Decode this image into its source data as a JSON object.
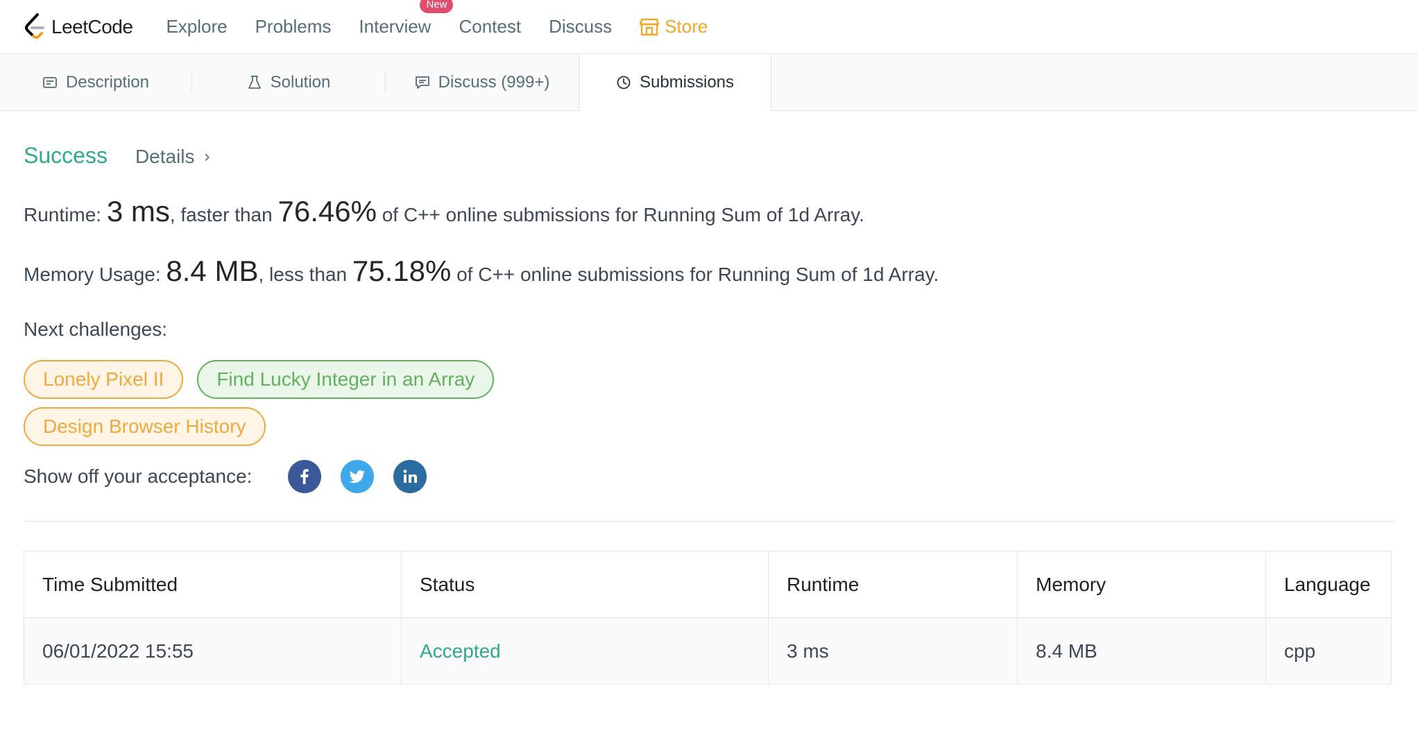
{
  "nav": {
    "logo_text": "LeetCode",
    "items": [
      "Explore",
      "Problems",
      "Interview",
      "Contest",
      "Discuss"
    ],
    "interview_badge": "New",
    "store_label": "Store"
  },
  "tabs": [
    {
      "label": "Description",
      "icon": "description-icon"
    },
    {
      "label": "Solution",
      "icon": "flask-icon"
    },
    {
      "label": "Discuss (999+)",
      "icon": "chat-icon"
    },
    {
      "label": "Submissions",
      "icon": "clock-icon",
      "active": true
    }
  ],
  "result": {
    "status": "Success",
    "details_label": "Details",
    "runtime": {
      "label": "Runtime: ",
      "value": "3 ms",
      "mid": ", faster than ",
      "percent": "76.46%",
      "suffix": " of C++ online submissions for Running Sum of 1d Array."
    },
    "memory": {
      "label": "Memory Usage: ",
      "value": "8.4 MB",
      "mid": ", less than ",
      "percent": "75.18%",
      "suffix": " of C++ online submissions for Running Sum of 1d Array."
    },
    "next_label": "Next challenges:",
    "challenges": [
      {
        "title": "Lonely Pixel II",
        "difficulty": "medium"
      },
      {
        "title": "Find Lucky Integer in an Array",
        "difficulty": "easy"
      },
      {
        "title": "Design Browser History",
        "difficulty": "medium"
      }
    ],
    "share_label": "Show off your acceptance:"
  },
  "table": {
    "headers": [
      "Time Submitted",
      "Status",
      "Runtime",
      "Memory",
      "Language"
    ],
    "rows": [
      [
        "06/01/2022 15:55",
        "Accepted",
        "3 ms",
        "8.4 MB",
        "cpp"
      ]
    ]
  },
  "colors": {
    "success": "#2fa98a",
    "store": "#f5a623",
    "medium": "#f0a93f",
    "easy": "#63b15f",
    "badge": "#e14d6f"
  }
}
